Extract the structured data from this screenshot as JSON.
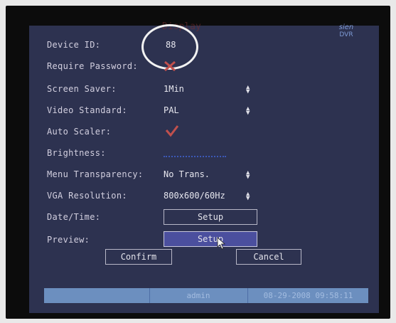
{
  "window": {
    "title": "Display",
    "logo": "sien DVR"
  },
  "fields": {
    "device_id": {
      "label": "Device ID:",
      "value": "88"
    },
    "require_password": {
      "label": "Require Password:"
    },
    "screen_saver": {
      "label": "Screen Saver:",
      "value": "1Min"
    },
    "video_standard": {
      "label": "Video Standard:",
      "value": "PAL"
    },
    "auto_scaler": {
      "label": "Auto Scaler:"
    },
    "brightness": {
      "label": "Brightness:"
    },
    "menu_transparency": {
      "label": "Menu Transparency:",
      "value": "No Trans."
    },
    "vga_resolution": {
      "label": "VGA Resolution:",
      "value": "800x600/60Hz"
    },
    "date_time": {
      "label": "Date/Time:",
      "button": "Setup"
    },
    "preview": {
      "label": "Preview:",
      "button": "Setup"
    }
  },
  "actions": {
    "confirm": "Confirm",
    "cancel": "Cancel"
  },
  "status": {
    "user": "admin",
    "datetime": "08-29-2008 09:58:11"
  },
  "colors": {
    "background": "#2d3250",
    "checkbox": "#c0504d",
    "selected_button": "#4b4f9e",
    "status_bar": "#6c8fbf"
  }
}
